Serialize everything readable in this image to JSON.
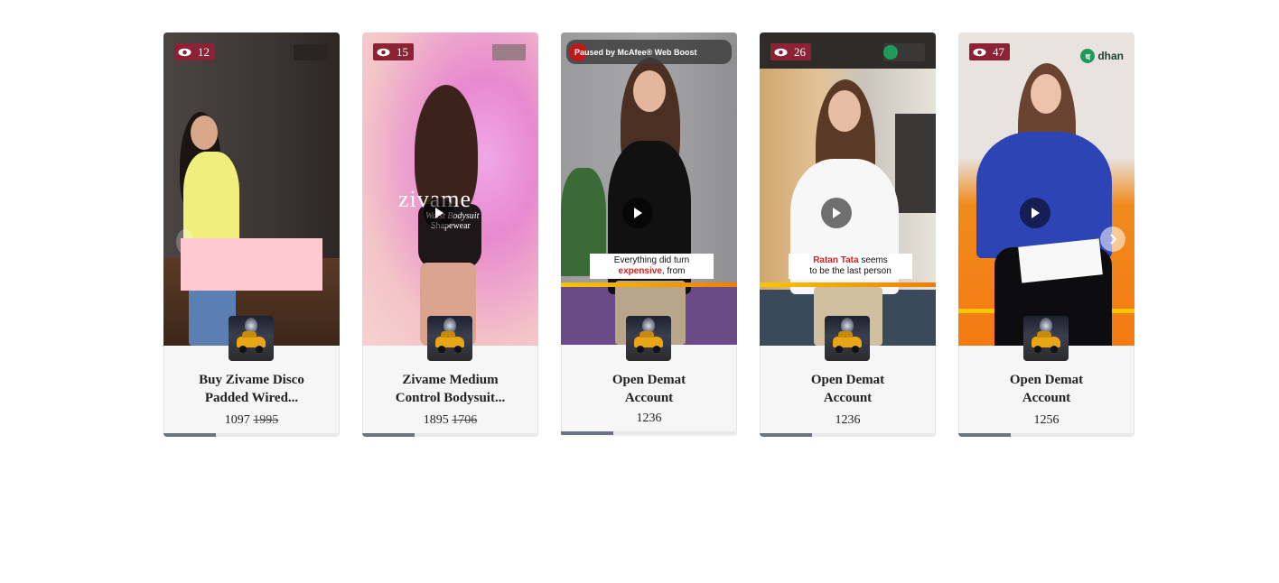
{
  "cards": [
    {
      "views": "12",
      "title_line1": "Buy Zivame Disco",
      "title_line2": "Padded Wired...",
      "price": "1097",
      "old_price": "1995",
      "progress": 0.3
    },
    {
      "views": "15",
      "title_line1": "Zivame Medium",
      "title_line2": "Control Bodysuit...",
      "price": "1895",
      "old_price": "1706",
      "brand": "zivame",
      "brand_sub1": "Waist Bodysuit",
      "brand_sub2": "Shapewear",
      "progress": 0.3
    },
    {
      "overlay": "Paused by McAfee® Web Boost",
      "title_line1": "Open Demat",
      "title_line2": "Account",
      "price": "1236",
      "caption_line1": "Everything did turn",
      "caption_red": "expensive",
      "caption_rest": ", from",
      "progress": 0.3
    },
    {
      "views": "26",
      "title_line1": "Open Demat",
      "title_line2": "Account",
      "price": "1236",
      "caption_red": "Ratan Tata",
      "caption_rest": " seems",
      "caption_line2": "to be the last person",
      "progress": 0.3
    },
    {
      "views": "47",
      "title_line1": "Open Demat",
      "title_line2": "Account",
      "price": "1256",
      "logo": "dhan",
      "progress": 0.3
    }
  ],
  "colors": {
    "view_badge": "#8b2335",
    "progress_fill": "#6b7280",
    "pink_overlay": "#ffc9d2"
  },
  "icons": [
    "eye-icon",
    "play-icon",
    "chevron-right-icon",
    "car-thumbnail"
  ]
}
